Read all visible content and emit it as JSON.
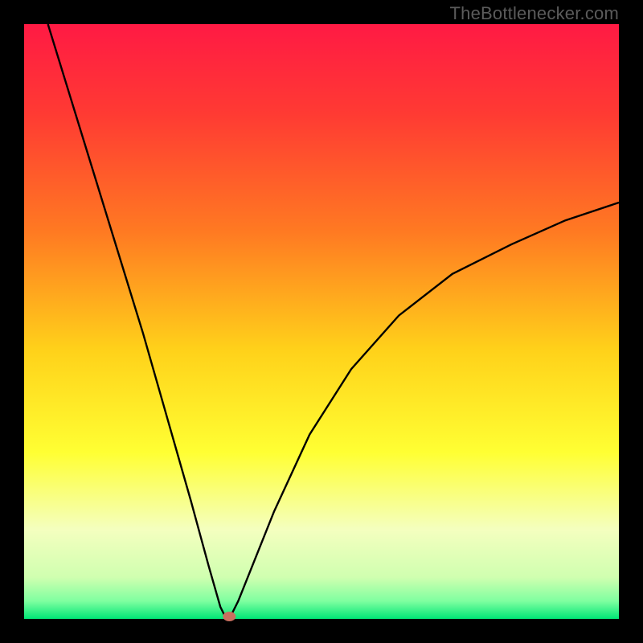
{
  "watermark": "TheBottlenecker.com",
  "chart_data": {
    "type": "line",
    "title": "",
    "xlabel": "",
    "ylabel": "",
    "x_range": [
      0,
      100
    ],
    "y_range": [
      0,
      100
    ],
    "frame": {
      "outer": [
        0,
        0,
        800,
        800
      ],
      "inner": [
        30,
        30,
        770,
        770
      ]
    },
    "gradient_stops": [
      {
        "offset": 0.0,
        "color": "#ff1a44"
      },
      {
        "offset": 0.15,
        "color": "#ff3a33"
      },
      {
        "offset": 0.35,
        "color": "#ff7a22"
      },
      {
        "offset": 0.55,
        "color": "#ffd21a"
      },
      {
        "offset": 0.72,
        "color": "#ffff33"
      },
      {
        "offset": 0.85,
        "color": "#f4ffbf"
      },
      {
        "offset": 0.93,
        "color": "#d0ffb0"
      },
      {
        "offset": 0.97,
        "color": "#7fffa0"
      },
      {
        "offset": 1.0,
        "color": "#00e676"
      }
    ],
    "curve": {
      "note": "x in [0,100], y in [0,100] (0 at bottom). Piecewise: left branch roughly linear from (4,100) to minimum near (34,0); right branch concave-increasing toward (100,~70).",
      "x": [
        4,
        8,
        12,
        16,
        20,
        24,
        28,
        31,
        33,
        34,
        35,
        36,
        38,
        42,
        48,
        55,
        63,
        72,
        82,
        91,
        100
      ],
      "y": [
        100,
        87,
        74,
        61,
        48,
        34,
        20,
        9,
        2,
        0,
        1,
        3,
        8,
        18,
        31,
        42,
        51,
        58,
        63,
        67,
        70
      ]
    },
    "marker": {
      "x": 34.5,
      "y": 0.4,
      "color": "#c96f5f"
    }
  }
}
